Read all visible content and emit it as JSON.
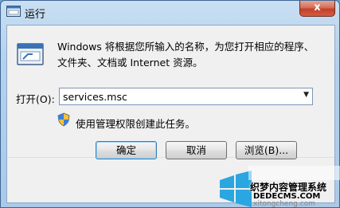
{
  "titlebar": {
    "title": "运行",
    "close_label": "x"
  },
  "dialog": {
    "description": "Windows 将根据您所输入的名称，为您打开相应的程序、文件夹、文档或 Internet 资源。",
    "open_label": "打开(O):",
    "command_value": "services.msc",
    "admin_note": "使用管理权限创建此任务。"
  },
  "buttons": {
    "ok": "确定",
    "cancel": "取消",
    "browse": "浏览(B)..."
  },
  "watermark": {
    "line1": "织梦内容管理系统",
    "line2": "DEDECMS.COM",
    "line3": "xitongcheng.com"
  },
  "icons": {
    "title": "run-icon",
    "run": "run-icon",
    "shield": "uac-shield-icon",
    "close": "close-icon",
    "dropdown": "chevron-down-icon"
  },
  "colors": {
    "title_gradient": "#b4d1ec",
    "close_button": "#c0402b",
    "default_button_border": "#3c7fb1"
  }
}
